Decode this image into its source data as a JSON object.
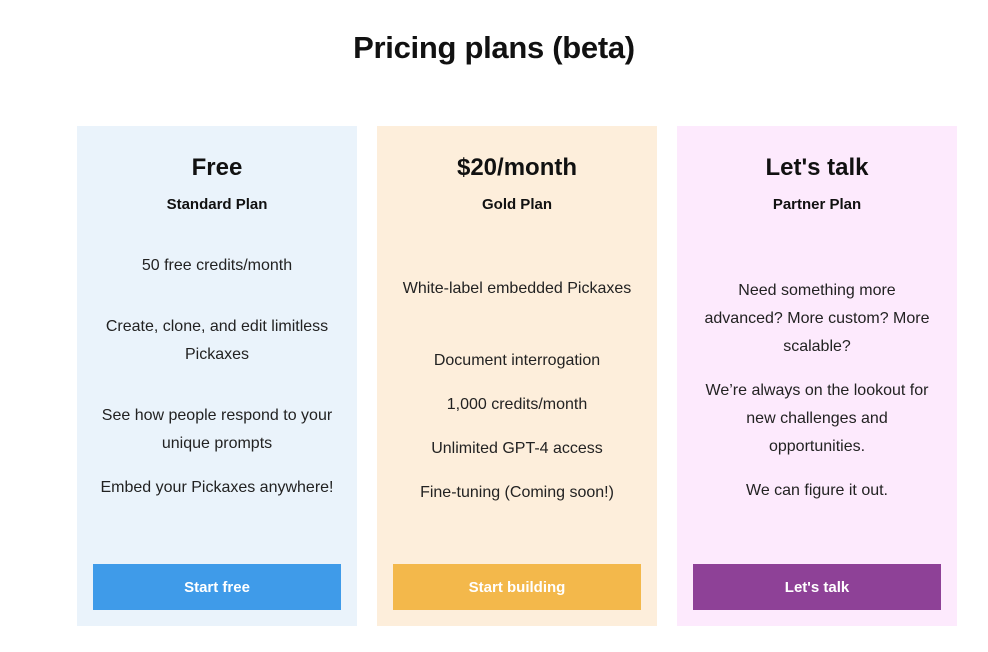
{
  "title": "Pricing plans (beta)",
  "plans": [
    {
      "price": "Free",
      "name": "Standard Plan",
      "features": [
        "50 free credits/month",
        "Create, clone, and edit limitless Pickaxes",
        "See how people respond to your unique prompts",
        "Embed your Pickaxes anywhere!"
      ],
      "cta": "Start free",
      "cta_color": "#3f9be9",
      "bg_color": "#eaf3fb"
    },
    {
      "price": "$20/month",
      "name": "Gold Plan",
      "features": [
        "White-label embedded Pickaxes",
        "Document interrogation",
        "1,000 credits/month",
        "Unlimited GPT-4 access",
        "Fine-tuning (Coming soon!)"
      ],
      "cta": "Start building",
      "cta_color": "#f3b84b",
      "bg_color": "#fdeedb"
    },
    {
      "price": "Let's talk",
      "name": "Partner Plan",
      "features": [
        "Need something more advanced? More custom? More scalable?",
        "We’re always on the lookout for new challenges and opportunities.",
        "We can figure it out."
      ],
      "cta": "Let's talk",
      "cta_color": "#8e4197",
      "bg_color": "#fdeafd"
    }
  ]
}
